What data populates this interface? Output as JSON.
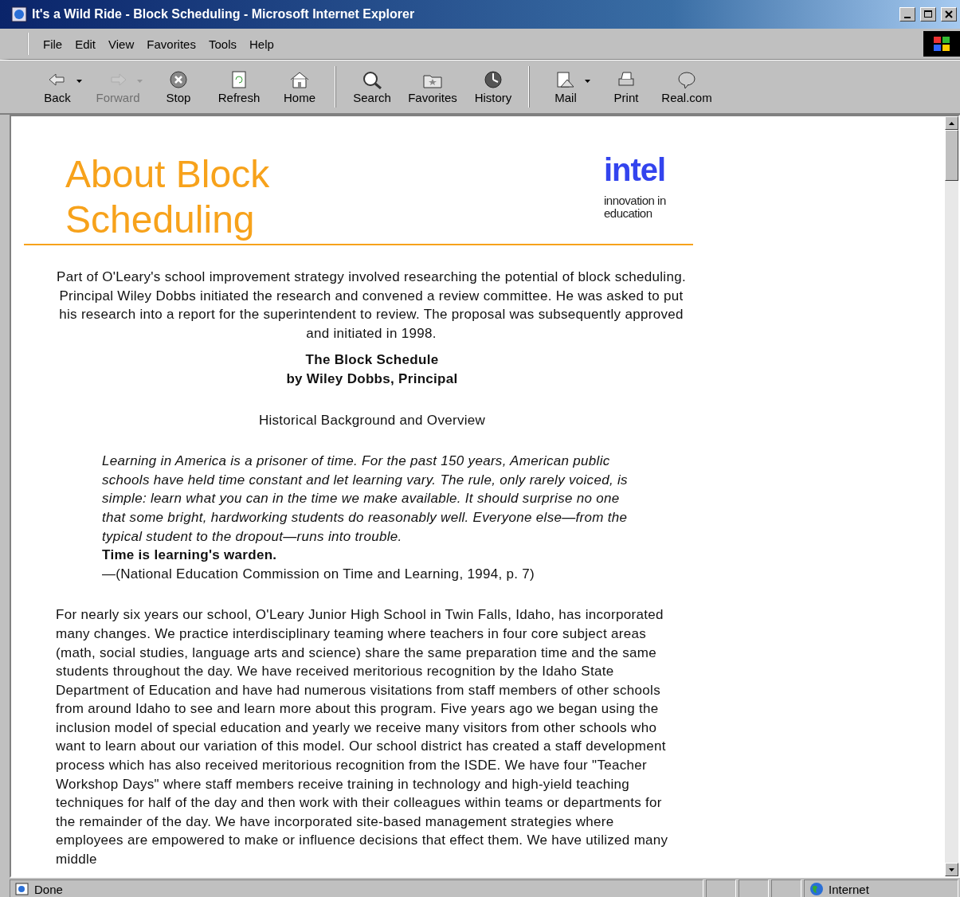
{
  "window": {
    "title": "It's a Wild Ride - Block Scheduling - Microsoft Internet Explorer"
  },
  "menu": [
    "File",
    "Edit",
    "View",
    "Favorites",
    "Tools",
    "Help"
  ],
  "toolbar": [
    {
      "label": "Back",
      "disabled": false,
      "dropdown": true,
      "separator_after": false
    },
    {
      "label": "Forward",
      "disabled": true,
      "dropdown": true,
      "separator_after": false
    },
    {
      "label": "Stop",
      "disabled": false,
      "dropdown": false,
      "separator_after": false
    },
    {
      "label": "Refresh",
      "disabled": false,
      "dropdown": false,
      "separator_after": false
    },
    {
      "label": "Home",
      "disabled": false,
      "dropdown": false,
      "separator_after": true
    },
    {
      "label": "Search",
      "disabled": false,
      "dropdown": false,
      "separator_after": false
    },
    {
      "label": "Favorites",
      "disabled": false,
      "dropdown": false,
      "separator_after": false
    },
    {
      "label": "History",
      "disabled": false,
      "dropdown": false,
      "separator_after": true
    },
    {
      "label": "Mail",
      "disabled": false,
      "dropdown": true,
      "separator_after": false
    },
    {
      "label": "Print",
      "disabled": false,
      "dropdown": false,
      "separator_after": false
    },
    {
      "label": "Real.com",
      "disabled": false,
      "dropdown": false,
      "separator_after": false
    }
  ],
  "page": {
    "heading": "About Block Scheduling",
    "logo": {
      "wordmark": "intel",
      "tagline": "innovation in education"
    },
    "intro": "Part of O'Leary's school improvement strategy involved researching the potential of block scheduling. Principal Wiley Dobbs initiated the research and convened a review committee. He was asked to put his research into a report for the superintendent to review. The proposal was subsequently approved and initiated in 1998.",
    "article_title": "The Block Schedule",
    "byline": "by Wiley Dobbs, Principal",
    "section": "Historical Background and Overview",
    "quote": "Learning in America is a prisoner of time. For the past 150 years, American public schools have held time constant and let learning vary. The rule, only rarely voiced, is simple: learn what you can in the time we make available. It should surprise no one that some bright, hardworking students do reasonably well. Everyone else—from the typical student to the dropout—runs into trouble.",
    "quote_emphasis": "Time is learning's warden.",
    "citation": "—(National Education Commission on Time and Learning, 1994, p. 7)",
    "body": "For nearly six years our school, O'Leary Junior High School in Twin Falls, Idaho, has incorporated many changes. We practice interdisciplinary teaming where teachers in four core subject areas (math, social studies, language arts and science) share the same preparation time and the same students throughout the day. We have received meritorious recognition by the Idaho State Department of Education and have had numerous visitations from staff members of other schools from around Idaho to see and learn more about this program. Five years ago we began using the inclusion model of special education and yearly we receive many visitors from other schools who want to learn about our variation of this model. Our school district has created a staff development process which has also received meritorious recognition from the ISDE. We have four \"Teacher Workshop Days\" where staff members receive training in technology and high-yield teaching techniques for half of the day and then work with their colleagues within teams or departments for the remainder of the day. We have incorporated site-based management strategies where employees are empowered to make or influence decisions that effect them. We have utilized many middle"
  },
  "status_bar": {
    "text": "Done",
    "zone": "Internet"
  }
}
